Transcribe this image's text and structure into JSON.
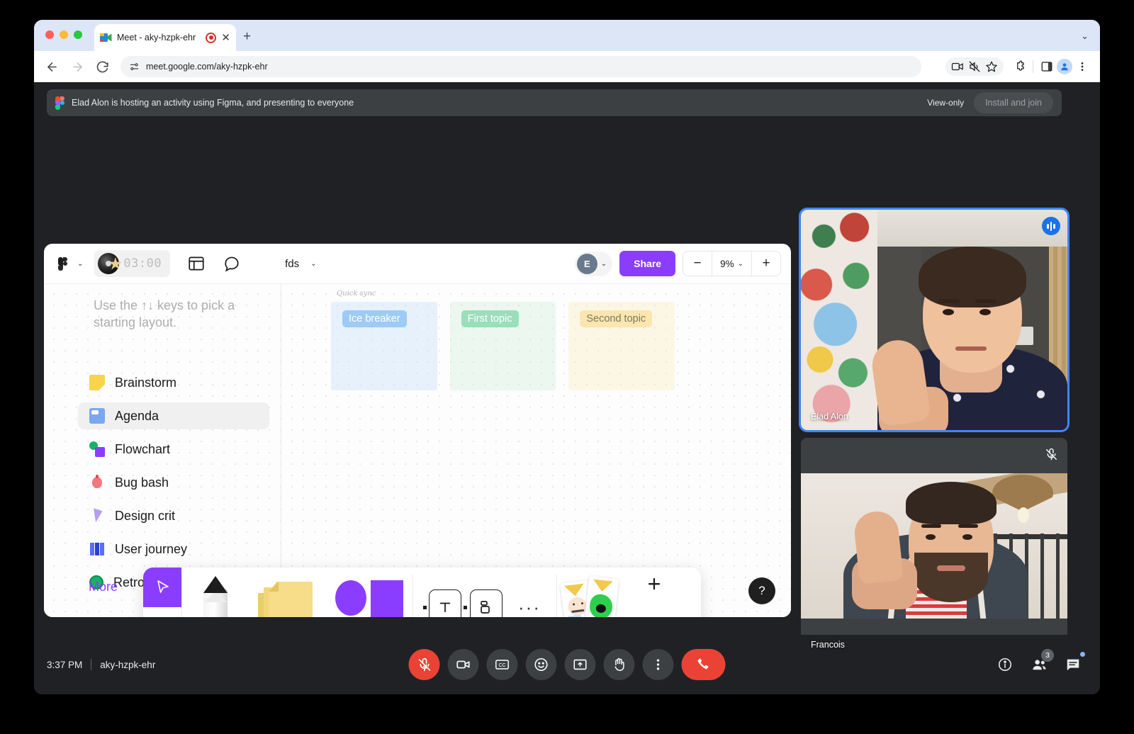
{
  "browser": {
    "tab": {
      "title": "Meet - aky-hzpk-ehr",
      "recording_icon": "record-icon",
      "close_icon": "close-icon"
    },
    "new_tab_label": "+",
    "window_chevron": "chevron-down-icon",
    "nav": {
      "back_icon": "back-arrow-icon",
      "forward_icon": "forward-arrow-icon",
      "reload_icon": "reload-icon",
      "site_info_icon": "site-settings-icon",
      "url_prefix": "meet.google.com",
      "url_path": "/aky-hzpk-ehr",
      "url_full": "meet.google.com/aky-hzpk-ehr"
    },
    "toolbar_icons": [
      "screen-share-icon",
      "mute-site-icon",
      "bookmark-star-icon",
      "extensions-icon",
      "side-panel-icon",
      "profile-avatar-icon",
      "more-menu-icon"
    ]
  },
  "banner": {
    "app_icon": "figma-logo-icon",
    "text": "Elad Alon is hosting an activity using Figma, and presenting to everyone",
    "view_only_label": "View-only",
    "install_button_label": "Install and join"
  },
  "figma": {
    "menu_icon": "figma-logo-icon",
    "timer": "03:00",
    "timer_icon": "music-disc-star-icon",
    "layout_icon": "layout-grid-icon",
    "comment_icon": "comment-bubble-icon",
    "doc_name": "fds",
    "avatar_initial": "E",
    "share_label": "Share",
    "zoom_minus": "−",
    "zoom_value": "9%",
    "zoom_plus": "+",
    "hint_text": "Use the ↑↓ keys to pick a starting layout.",
    "layouts": [
      {
        "label": "Brainstorm",
        "icon": "sticky-note-icon",
        "selected": false
      },
      {
        "label": "Agenda",
        "icon": "agenda-board-icon",
        "selected": true
      },
      {
        "label": "Flowchart",
        "icon": "flowchart-icon",
        "selected": false
      },
      {
        "label": "Bug bash",
        "icon": "bug-icon",
        "selected": false
      },
      {
        "label": "Design crit",
        "icon": "pen-nib-icon",
        "selected": false
      },
      {
        "label": "User journey",
        "icon": "map-icon",
        "selected": false
      },
      {
        "label": "Retro",
        "icon": "stopwatch-icon",
        "selected": false
      }
    ],
    "more_label": "More",
    "frame_title": "Quick sync",
    "cards": [
      {
        "label": "Ice breaker",
        "color": "blue"
      },
      {
        "label": "First topic",
        "color": "green"
      },
      {
        "label": "Second topic",
        "color": "yellow"
      }
    ],
    "tools": [
      {
        "name": "move-tool",
        "icon": "cursor-arrow-icon",
        "active": true
      },
      {
        "name": "hand-tool",
        "icon": "hand-icon",
        "active": false
      },
      {
        "name": "pen-tool",
        "icon": "marker-pen-icon",
        "active": false
      },
      {
        "name": "sticky-note-tool",
        "icon": "sticky-notes-icon",
        "active": false
      },
      {
        "name": "shapes-tool",
        "icon": "shapes-icon",
        "active": false
      },
      {
        "name": "text-tool",
        "icon": "text-t-icon",
        "active": false
      },
      {
        "name": "section-tool",
        "icon": "section-frame-icon",
        "active": false
      },
      {
        "name": "more-tools",
        "icon": "ellipsis-icon",
        "active": false
      },
      {
        "name": "stickers-tool",
        "icon": "stickers-icon",
        "active": false
      },
      {
        "name": "add-tool",
        "icon": "plus-icon",
        "active": false
      }
    ],
    "help_label": "?"
  },
  "tiles": [
    {
      "name": "Elad Alon",
      "status": "speaking",
      "badge_icon": "audio-level-icon",
      "active_speaker": true
    },
    {
      "name": "Francois",
      "status": "muted",
      "badge_icon": "mic-off-icon",
      "active_speaker": false
    }
  ],
  "bottom_bar": {
    "time": "3:37 PM",
    "meeting_code": "aky-hzpk-ehr",
    "controls": [
      {
        "name": "microphone-button",
        "icon": "mic-off-icon",
        "state": "muted",
        "danger": true
      },
      {
        "name": "camera-button",
        "icon": "camera-icon",
        "state": "on",
        "danger": false
      },
      {
        "name": "captions-button",
        "icon": "closed-captions-icon",
        "state": "off",
        "danger": false
      },
      {
        "name": "reactions-button",
        "icon": "emoji-smile-icon",
        "state": "off",
        "danger": false
      },
      {
        "name": "present-button",
        "icon": "present-screen-icon",
        "state": "off",
        "danger": false
      },
      {
        "name": "raise-hand-button",
        "icon": "raised-hand-icon",
        "state": "off",
        "danger": false
      },
      {
        "name": "more-options-button",
        "icon": "vertical-ellipsis-icon",
        "state": "off",
        "danger": false
      }
    ],
    "leave_button": {
      "name": "leave-call-button",
      "icon": "hang-up-icon"
    },
    "right_controls": [
      {
        "name": "meeting-details-button",
        "icon": "info-circle-icon",
        "badge": null,
        "dot": false
      },
      {
        "name": "participants-button",
        "icon": "people-icon",
        "badge": "3",
        "dot": false
      },
      {
        "name": "chat-button",
        "icon": "chat-icon",
        "badge": null,
        "dot": true
      }
    ]
  },
  "colors": {
    "accent_purple": "#8b3dff",
    "meet_red": "#ea4335",
    "meet_blue": "#4285f4",
    "dark_bg": "#202124",
    "banner_bg": "#3c4043"
  }
}
